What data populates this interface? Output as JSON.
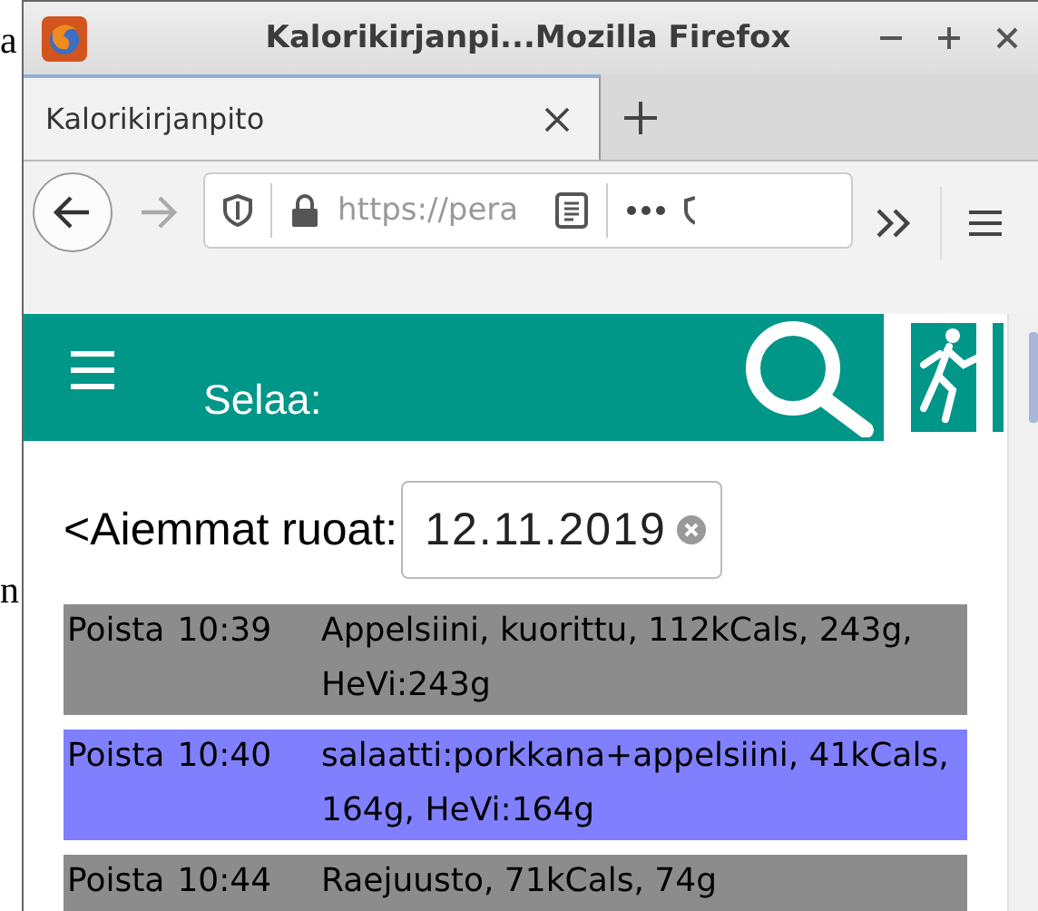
{
  "background_texts": [
    "a",
    "n"
  ],
  "window": {
    "title": "Kalorikirjanpi...Mozilla Firefox"
  },
  "tabs": [
    {
      "label": "Kalorikirjanpito",
      "selected": true
    }
  ],
  "address_bar": {
    "url": "https://pera"
  },
  "header": {
    "title": "Selaa:"
  },
  "date_filter": {
    "label": "<Aiemmat ruoat:",
    "value": "12.11.2019"
  },
  "entries": [
    {
      "action": "Poista",
      "time": "10:39",
      "text": "Appelsiini, kuorittu, 112kCals, 243g, HeVi:243g",
      "color": "#8c8c8c"
    },
    {
      "action": "Poista",
      "time": "10:40",
      "text": "salaatti:porkkana+appelsiini, 41kCals, 164g, HeVi:164g",
      "color": "#8080ff"
    },
    {
      "action": "Poista",
      "time": "10:44",
      "text": "Raejuusto, 71kCals, 74g",
      "color": "#8c8c8c"
    }
  ]
}
